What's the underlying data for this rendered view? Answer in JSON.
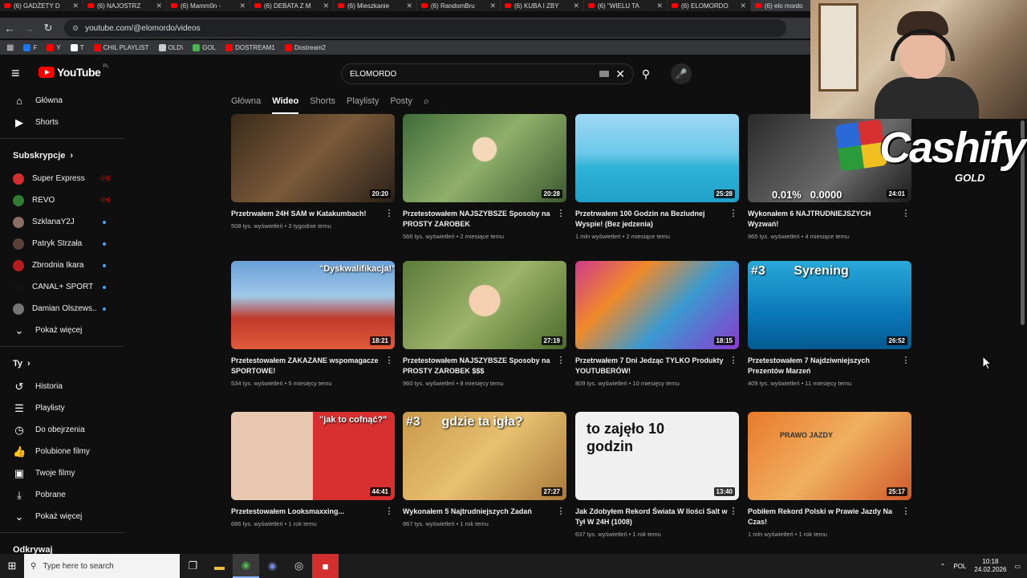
{
  "browser": {
    "tabs": [
      {
        "title": "(6) GADŻETY D"
      },
      {
        "title": "(6) NAJOSTRZ"
      },
      {
        "title": "(6) Mamm0n -"
      },
      {
        "title": "(6) DEBATA Z M"
      },
      {
        "title": "(6) Mieszkanie"
      },
      {
        "title": "(6) RandomBru"
      },
      {
        "title": "(6) KUBA I ZBY"
      },
      {
        "title": "(6) \"WIELU TA"
      },
      {
        "title": "(6) ELOMORDO"
      },
      {
        "title": "(6) elo mordo"
      }
    ],
    "url": "youtube.com/@elomordo/videos",
    "bookmarks": [
      {
        "label": "F",
        "color": "#1877f2"
      },
      {
        "label": "Y",
        "color": "#ff0000"
      },
      {
        "label": "T",
        "color": "#ffffff"
      },
      {
        "label": "CHIL PLAYLIST",
        "color": "#ff0000"
      },
      {
        "label": "OLD\\",
        "color": "#cccccc"
      },
      {
        "label": "GOL",
        "color": "#4caf50"
      },
      {
        "label": "DOSTREAM1",
        "color": "#ff0000"
      },
      {
        "label": "Dostream2",
        "color": "#ff0000"
      }
    ]
  },
  "youtube": {
    "logo_text": "YouTube",
    "logo_region": "PL",
    "search_value": "ELOMORDO",
    "channel_tabs": [
      "Główna",
      "Wideo",
      "Shorts",
      "Playlisty",
      "Posty"
    ],
    "active_tab": "Wideo"
  },
  "sidebar": {
    "main": [
      {
        "label": "Główna",
        "icon": "home-icon"
      },
      {
        "label": "Shorts",
        "icon": "shorts-icon"
      }
    ],
    "subs_heading": "Subskrypcje",
    "subscriptions": [
      {
        "name": "Super Express",
        "status": "live",
        "color": "#d32f2f"
      },
      {
        "name": "REVO",
        "status": "live",
        "color": "#2e7d32"
      },
      {
        "name": "SzklanaY2J",
        "status": "new",
        "color": "#8d6e63"
      },
      {
        "name": "Patryk Strzała",
        "status": "new",
        "color": "#5d4037"
      },
      {
        "name": "Zbrodnia Ikara",
        "status": "new",
        "color": "#b71c1c"
      },
      {
        "name": "CANAL+ SPORT",
        "status": "new",
        "color": "#111111"
      },
      {
        "name": "Damian Olszews...",
        "status": "new",
        "color": "#757575"
      }
    ],
    "show_more": "Pokaż więcej",
    "you_heading": "Ty",
    "you_items": [
      {
        "label": "Historia",
        "icon": "history-icon"
      },
      {
        "label": "Playlisty",
        "icon": "playlist-icon"
      },
      {
        "label": "Do obejrzenia",
        "icon": "watch-later-icon"
      },
      {
        "label": "Polubione filmy",
        "icon": "like-icon"
      },
      {
        "label": "Twoje filmy",
        "icon": "your-videos-icon"
      },
      {
        "label": "Pobrane",
        "icon": "download-icon"
      }
    ],
    "show_more_2": "Pokaż więcej",
    "next_heading": "Odkrywaj"
  },
  "videos": [
    {
      "title": "Przetrwałem 24H SAM w Katakumbach!",
      "stats": "508 tys. wyświetleń • 3 tygodnie temu",
      "duration": "20:20",
      "overlay": ""
    },
    {
      "title": "Przetestowałem NAJSZYBSZE Sposoby na PROSTY ZAROBEK",
      "stats": "566 tys. wyświetleń • 2 miesiące temu",
      "duration": "20:28",
      "overlay": ""
    },
    {
      "title": "Przetrwałem 100 Godzin na Bezludnej Wyspie! (Bez jedzenia)",
      "stats": "1 mln wyświetleń • 2 miesiące temu",
      "duration": "25:28",
      "overlay": ""
    },
    {
      "title": "Wykonałem 6 NAJTRUDNIEJSZYCH Wyzwań!",
      "stats": "965 tys. wyświetleń • 4 miesiące temu",
      "duration": "24:01",
      "overlay": "0.01%   0.0000"
    },
    {
      "title": "Przetestowałem ZAKAZANE wspomagacze SPORTOWE!",
      "stats": "534 tys. wyświetleń • 5 miesięcy temu",
      "duration": "18:21",
      "overlay": "\"Dyskwalifikacja!\""
    },
    {
      "title": "Przetestowałem NAJSZYBSZE Sposoby na PROSTY ZAROBEK $$$",
      "stats": "960 tys. wyświetleń • 8 miesięcy temu",
      "duration": "27:19",
      "overlay": ""
    },
    {
      "title": "Przetrwałem 7 Dni Jedząc TYLKO Produkty YOUTUBERÓW!",
      "stats": "809 tys. wyświetleń • 10 miesięcy temu",
      "duration": "18:15",
      "overlay": ""
    },
    {
      "title": "Przetestowałem 7 Najdziwniejszych Prezentów Marzeń",
      "stats": "409 tys. wyświetleń • 11 miesięcy temu",
      "duration": "26:52",
      "overlay": "#3        Syrening"
    },
    {
      "title": "Przetestowałem Looksmaxxing...",
      "stats": "686 tys. wyświetleń • 1 rok temu",
      "duration": "44:41",
      "overlay": "\"jak to cofnąć?\""
    },
    {
      "title": "Wykonałem 5 Najtrudniejszych Zadań",
      "stats": "867 tys. wyświetleń • 1 rok temu",
      "duration": "27:27",
      "overlay": "#3      gdzie ta igła?"
    },
    {
      "title": "Jak Zdobyłem Rekord Świata W Ilości Salt w Tył W 24H (1008)",
      "stats": "637 tys. wyświetleń • 1 rok temu",
      "duration": "13:40",
      "overlay": "to zajęło 10 godzin"
    },
    {
      "title": "Pobiłem Rekord Polski w Prawie Jazdy Na Czas!",
      "stats": "1 mln wyświetleń • 1 rok temu",
      "duration": "25:17",
      "overlay": "PRAWO JAZDY"
    }
  ],
  "sponsor": {
    "brand": "Cashify",
    "tier": "GOLD"
  },
  "taskbar": {
    "search_placeholder": "Type here to search",
    "lang": "POL",
    "time": "10:18",
    "date": "24.02.2026"
  }
}
